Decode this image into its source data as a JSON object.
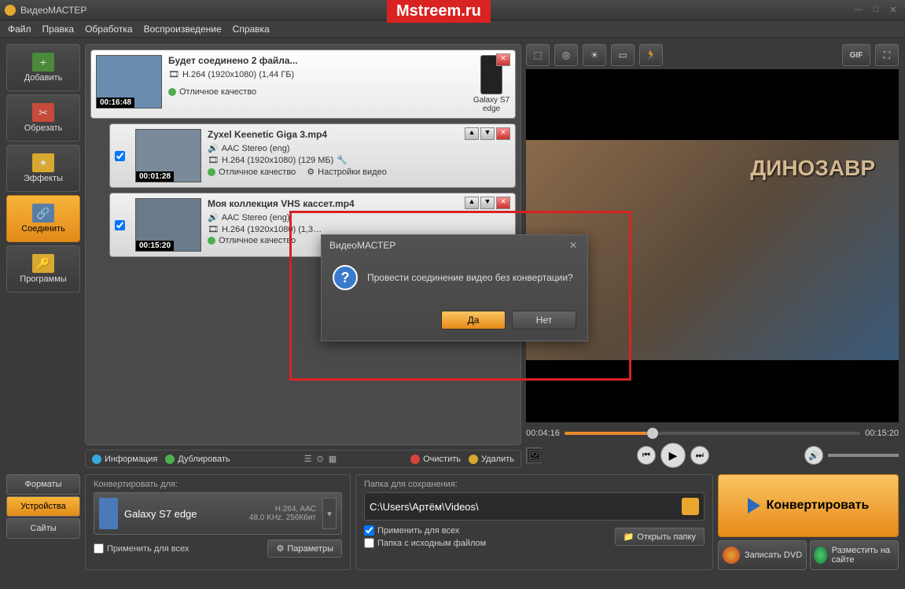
{
  "watermark": "Mstreem.ru",
  "window": {
    "title": "ВидеоМАСТЕР"
  },
  "menu": {
    "file": "Файл",
    "edit": "Правка",
    "process": "Обработка",
    "play": "Воспроизведение",
    "help": "Справка"
  },
  "sidebar": {
    "add": "Добавить",
    "cut": "Обрезать",
    "effects": "Эффекты",
    "join": "Соединить",
    "programs": "Программы"
  },
  "files": [
    {
      "title": "Будет соединено 2 файла...",
      "codec": "H.264 (1920x1080) (1,44 ГБ)",
      "quality": "Отличное качество",
      "duration": "00:16:48",
      "device": "Galaxy S7 edge"
    },
    {
      "title": "Zyxel Keenetic Giga 3.mp4",
      "audio": "AAC Stereo (eng)",
      "codec": "H.264 (1920x1080) (129 МБ)",
      "quality": "Отличное качество",
      "settings": "Настройки видео",
      "duration": "00:01:28"
    },
    {
      "title": "Моя коллекция VHS кассет.mp4",
      "audio": "AAC Stereo (eng)",
      "codec": "H.264 (1920x1080) (1,3…",
      "quality": "Отличное качество",
      "duration": "00:15:20"
    }
  ],
  "bottombar": {
    "info": "Информация",
    "dup": "Дублировать",
    "clear": "Очистить",
    "del": "Удалить"
  },
  "preview": {
    "current": "00:04:16",
    "total": "00:15:20",
    "poster": "ДИНОЗАВР"
  },
  "convert_panel": {
    "header": "Конвертировать для:",
    "device": "Galaxy S7 edge",
    "format": "H.264, AAC",
    "format2": "48,0 KHz, 256Кбит",
    "apply": "Применить для всех",
    "params": "Параметры"
  },
  "save_panel": {
    "header": "Папка для сохранения:",
    "path": "C:\\Users\\Артём\\Videos\\",
    "apply": "Применить для всех",
    "source": "Папка с исходным файлом",
    "open": "Открыть папку"
  },
  "tabs": {
    "formats": "Форматы",
    "devices": "Устройства",
    "sites": "Сайты"
  },
  "actions": {
    "convert": "Конвертировать",
    "dvd": "Записать DVD",
    "upload": "Разместить на сайте"
  },
  "dialog": {
    "title": "ВидеоМАСТЕР",
    "msg": "Провести соединение видео без конвертации?",
    "yes": "Да",
    "no": "Нет"
  }
}
